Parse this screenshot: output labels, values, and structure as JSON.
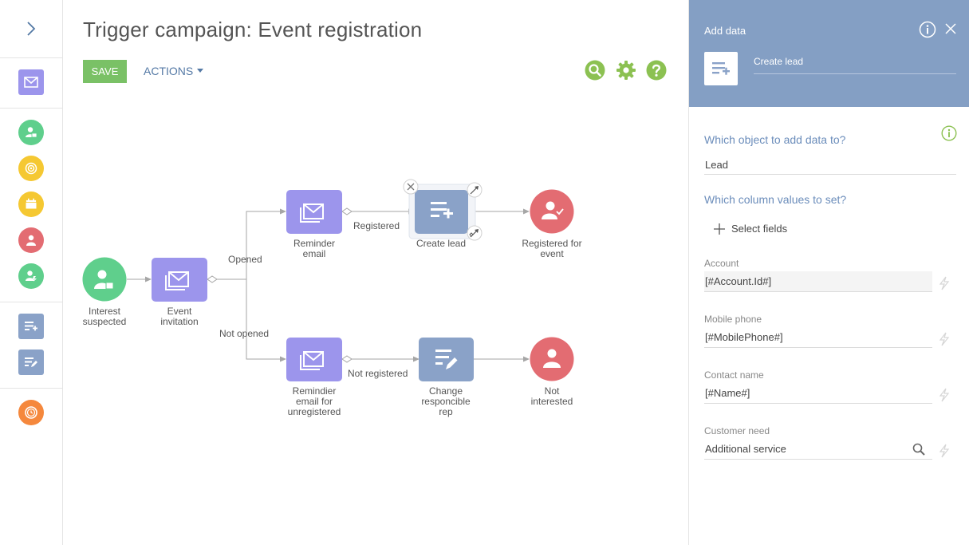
{
  "page": {
    "title": "Trigger campaign: Event registration"
  },
  "toolbar": {
    "save_label": "SAVE",
    "actions_label": "ACTIONS"
  },
  "colors": {
    "save": "#7ac166",
    "tool": "#8cc152",
    "accent_text": "#5479a5",
    "panel_header": "#849fc4",
    "heading": "#6b8dbb",
    "audience_green": "#5fcf8c",
    "email_purple": "#9c95ec",
    "action_blue": "#8aa2c8",
    "exit_red": "#e36c72",
    "goal_yellow": "#f5c832",
    "timer_orange": "#f5883d"
  },
  "rail": {
    "icons": [
      {
        "name": "chevron-right-icon"
      },
      {
        "name": "email-element-icon"
      },
      {
        "name": "audience-icon"
      },
      {
        "name": "target-icon"
      },
      {
        "name": "event-calendar-icon"
      },
      {
        "name": "exit-contact-icon"
      },
      {
        "name": "lead-action-icon"
      },
      {
        "name": "add-data-icon"
      },
      {
        "name": "modify-data-icon"
      },
      {
        "name": "timer-icon"
      }
    ]
  },
  "tools": [
    {
      "name": "search-icon"
    },
    {
      "name": "gear-icon"
    },
    {
      "name": "help-icon"
    }
  ],
  "flow": {
    "nodes": {
      "interest_suspected": {
        "label": "Interest\nsuspected"
      },
      "event_invitation": {
        "label": "Event\ninvitation"
      },
      "reminder_email": {
        "label": "Reminder\nemail"
      },
      "create_lead": {
        "label": "Create lead"
      },
      "registered_for_event": {
        "label": "Registered for\nevent"
      },
      "reminder_unregistered": {
        "label": "Remindier\nemail for\nunregistered"
      },
      "change_rep": {
        "label": "Change\nresponcible\nrep"
      },
      "not_interested": {
        "label": "Not\ninterested"
      }
    },
    "edges": {
      "opened": "Opened",
      "not_opened": "Not opened",
      "registered": "Registered",
      "not_registered": "Not registered"
    }
  },
  "panel": {
    "title": "Add data",
    "element_name": "Create lead",
    "object_heading": "Which object to add data to?",
    "object_value": "Lead",
    "columns_heading": "Which column values to set?",
    "select_fields_label": "Select fields",
    "fields": [
      {
        "caption": "Account",
        "value": "[#Account.Id#]"
      },
      {
        "caption": "Mobile phone",
        "value": "[#MobilePhone#]"
      },
      {
        "caption": "Contact name",
        "value": "[#Name#]"
      },
      {
        "caption": "Customer need",
        "value": "Additional service"
      }
    ]
  }
}
